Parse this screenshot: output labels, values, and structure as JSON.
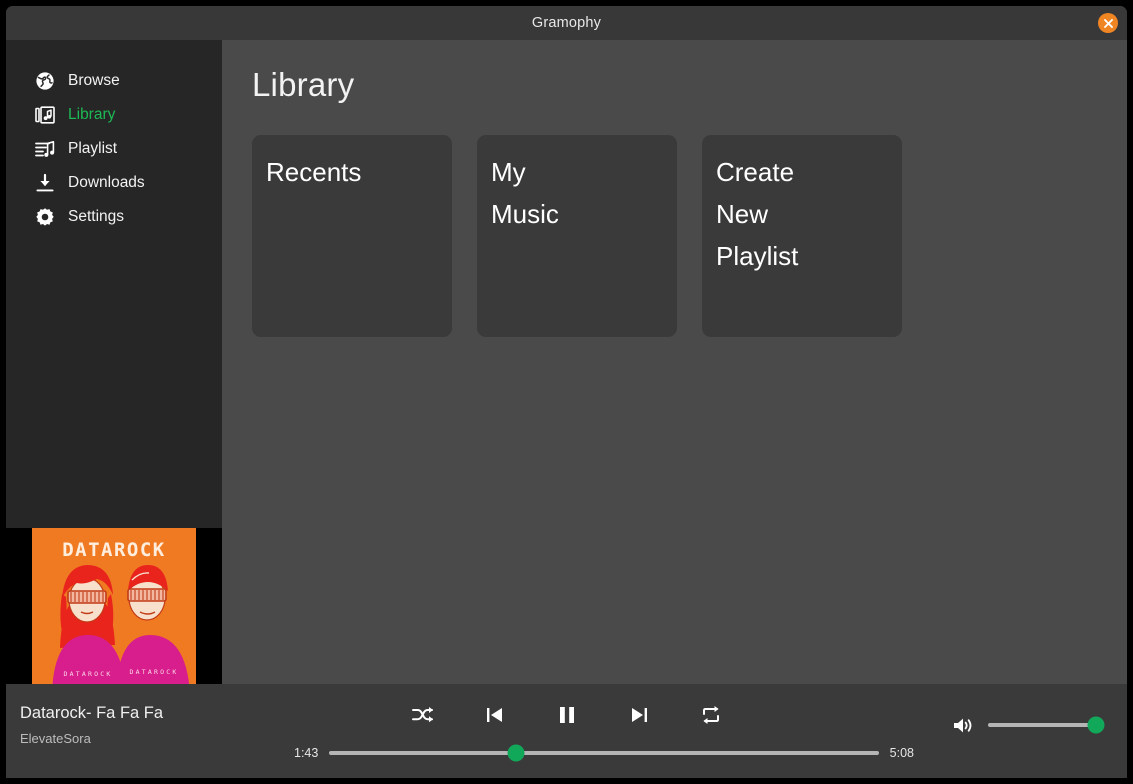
{
  "window": {
    "title": "Gramophy",
    "close_icon": "close-icon",
    "accent_color": "#1db954",
    "close_button_color": "#f08524"
  },
  "sidebar": {
    "items": [
      {
        "label": "Browse",
        "icon": "globe-icon",
        "active": false
      },
      {
        "label": "Library",
        "icon": "library-icon",
        "active": true
      },
      {
        "label": "Playlist",
        "icon": "playlist-icon",
        "active": false
      },
      {
        "label": "Downloads",
        "icon": "download-icon",
        "active": false
      },
      {
        "label": "Settings",
        "icon": "gear-icon",
        "active": false
      }
    ],
    "album_art": {
      "name": "album-art",
      "band_text": "DATAROCK",
      "shirt_text_left": "DATAROCK",
      "shirt_text_right": "DATAROCK",
      "background_color": "#f07a22",
      "shirt_color": "#d81e8c",
      "hair_color": "#e8241c"
    }
  },
  "main": {
    "page_title": "Library",
    "cards": [
      {
        "label": "Recents"
      },
      {
        "label": "My\nMusic"
      },
      {
        "label": "Create\nNew\nPlaylist"
      }
    ]
  },
  "player": {
    "track_title": "Datarock- Fa Fa Fa",
    "track_artist": "ElevateSora",
    "controls": [
      {
        "name": "shuffle-button",
        "icon": "shuffle-icon"
      },
      {
        "name": "previous-button",
        "icon": "skip-previous-icon"
      },
      {
        "name": "play-pause-button",
        "icon": "pause-icon"
      },
      {
        "name": "next-button",
        "icon": "skip-next-icon"
      },
      {
        "name": "repeat-button",
        "icon": "repeat-icon"
      }
    ],
    "elapsed_time": "1:43",
    "total_time": "5:08",
    "progress_percent": 34,
    "volume_percent": 100,
    "volume_icon": "volume-high-icon",
    "slider_fill_color": "#12a85a",
    "slider_track_color": "#b5b5b5"
  }
}
